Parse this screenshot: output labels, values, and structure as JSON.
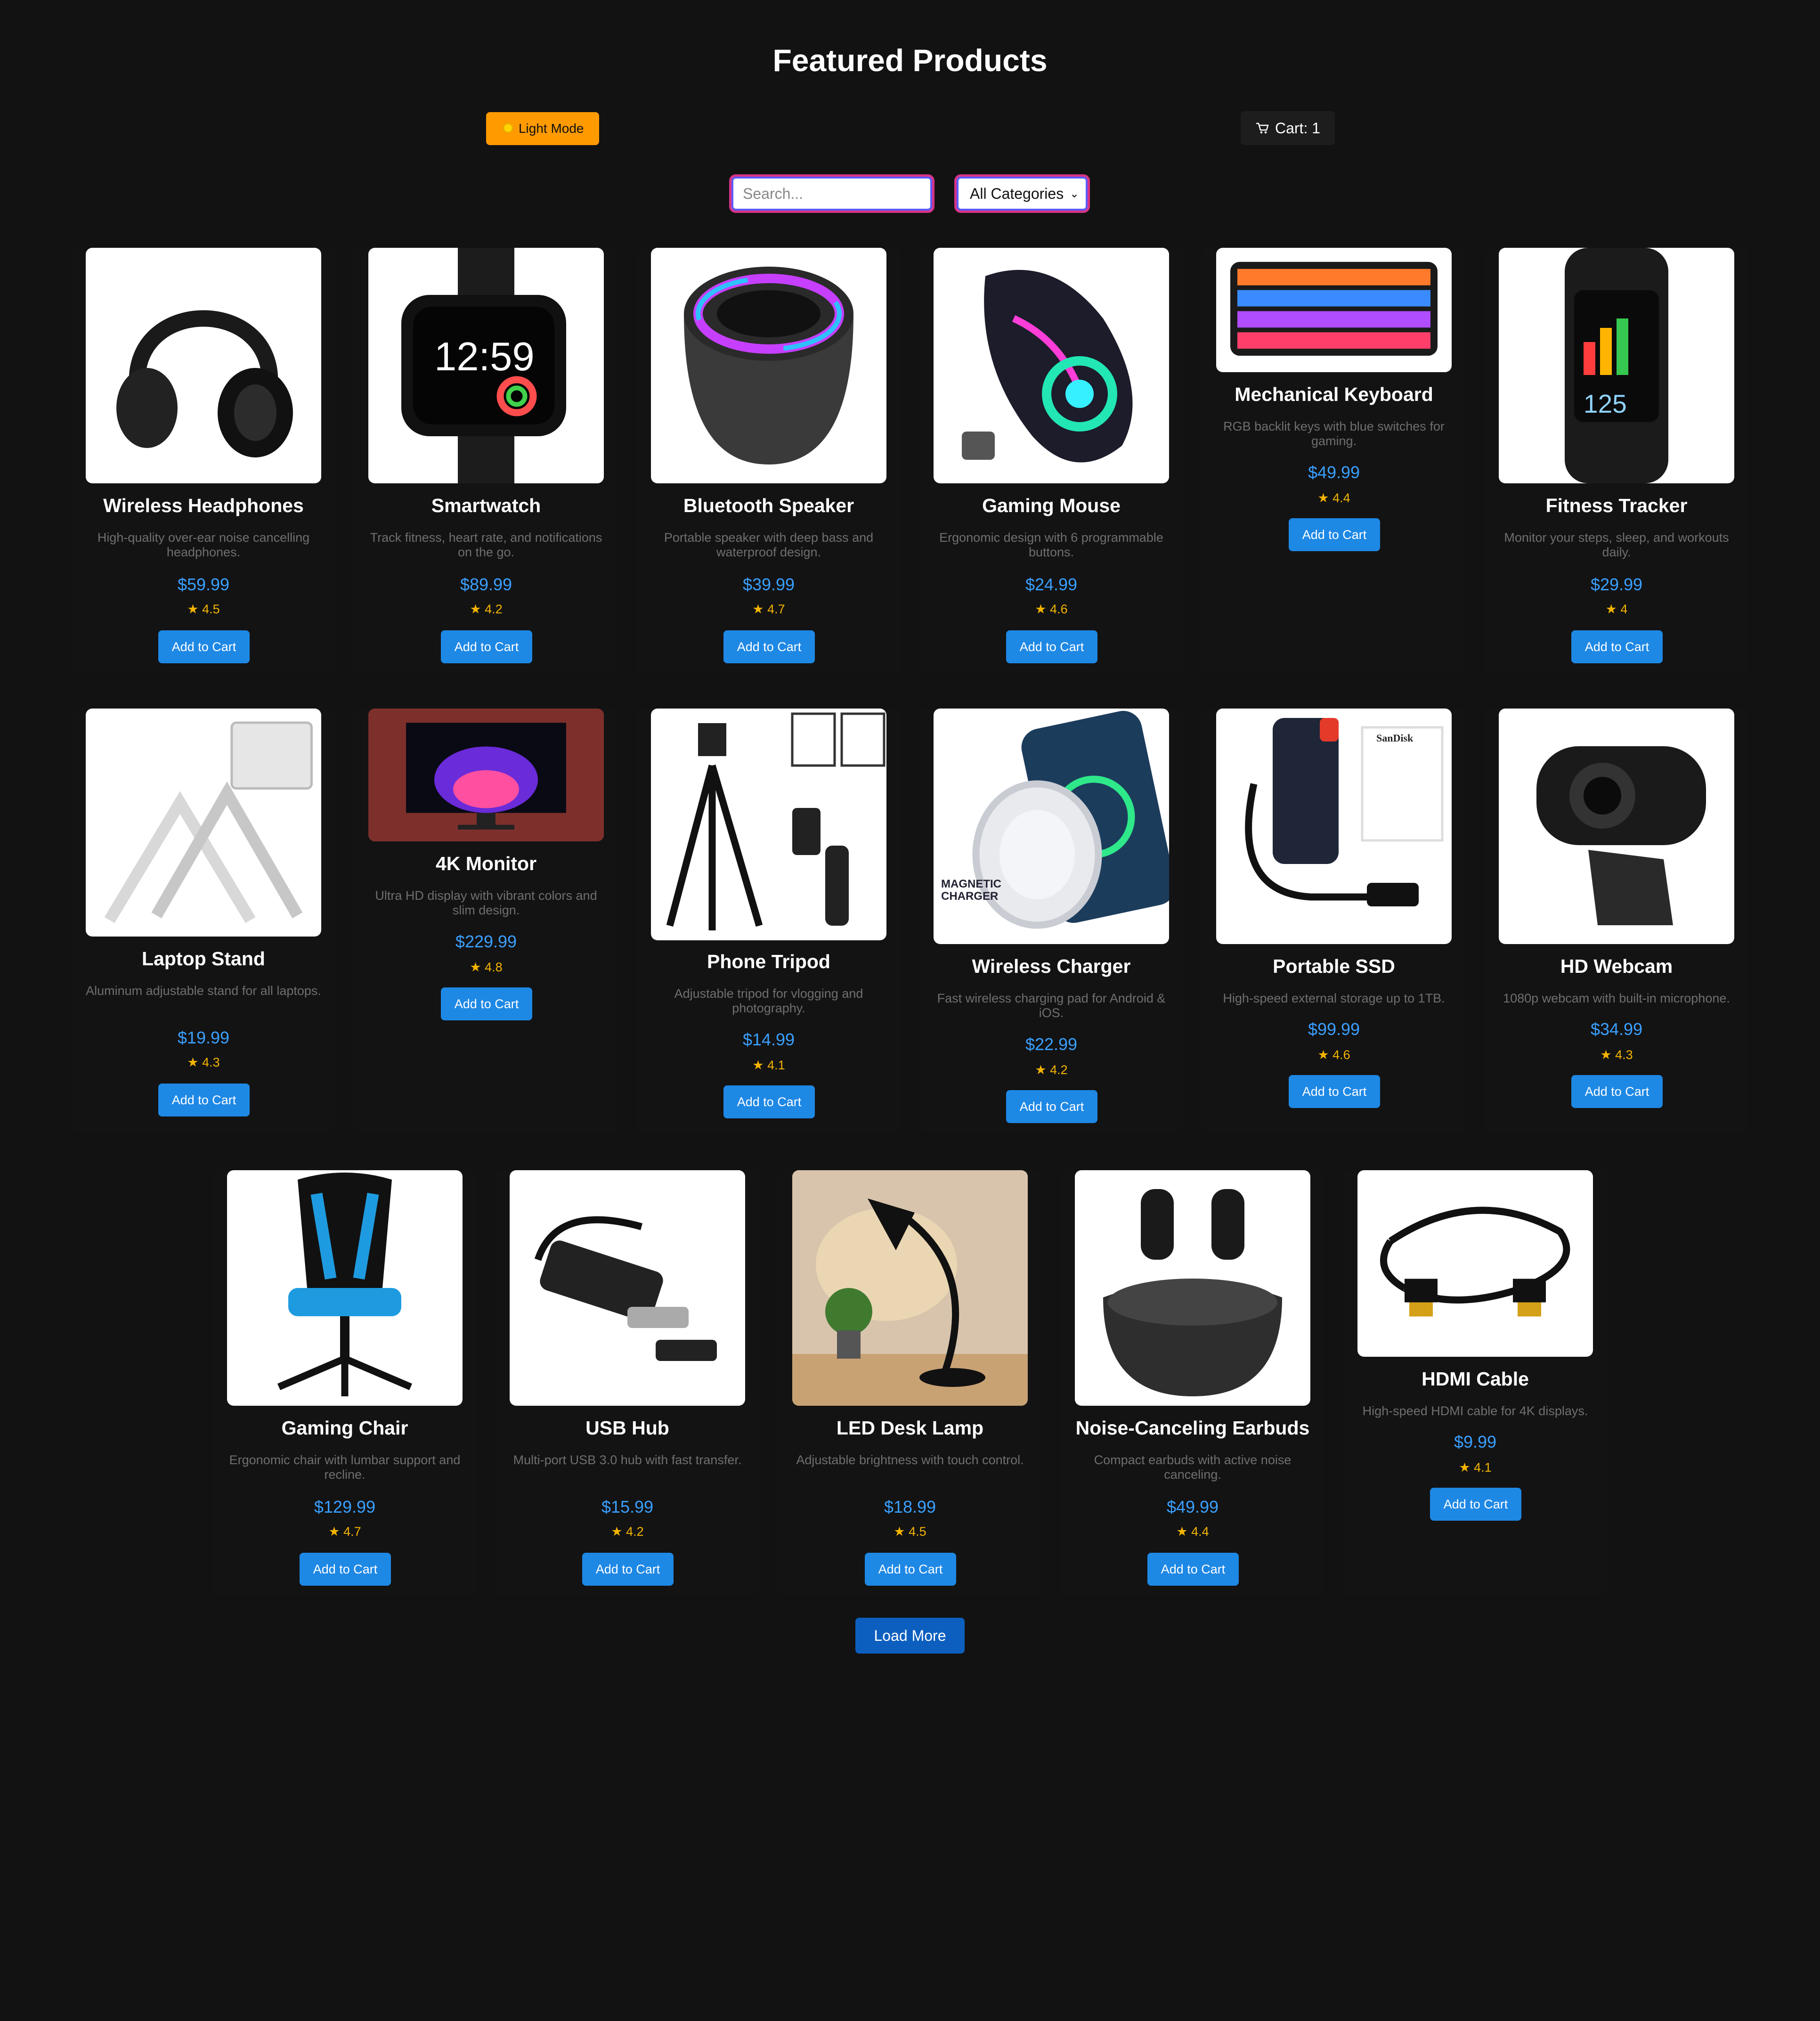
{
  "page": {
    "title": "Featured Products",
    "theme_toggle": "Light Mode",
    "cart_label": "Cart: 1",
    "search_placeholder": "Search...",
    "category_selected": "All Categories",
    "load_more": "Load More"
  },
  "colors": {
    "background": "#121212",
    "accent_blue": "#1e88e5",
    "price_blue": "#3aa0ff",
    "star_gold": "#f5b400",
    "theme_button": "#ff9a00",
    "input_border": "#d63384"
  },
  "products": [
    {
      "name": "Wireless Headphones",
      "desc": "High-quality over-ear noise cancelling headphones.",
      "price": "$59.99",
      "rating": "★ 4.5",
      "button": "Add to Cart"
    },
    {
      "name": "Smartwatch",
      "desc": "Track fitness, heart rate, and notifications on the go.",
      "price": "$89.99",
      "rating": "★ 4.2",
      "button": "Add to Cart"
    },
    {
      "name": "Bluetooth Speaker",
      "desc": "Portable speaker with deep bass and waterproof design.",
      "price": "$39.99",
      "rating": "★ 4.7",
      "button": "Add to Cart"
    },
    {
      "name": "Gaming Mouse",
      "desc": "Ergonomic design with 6 programmable buttons.",
      "price": "$24.99",
      "rating": "★ 4.6",
      "button": "Add to Cart"
    },
    {
      "name": "Mechanical Keyboard",
      "desc": "RGB backlit keys with blue switches for gaming.",
      "price": "$49.99",
      "rating": "★ 4.4",
      "button": "Add to Cart"
    },
    {
      "name": "Fitness Tracker",
      "desc": "Monitor your steps, sleep, and workouts daily.",
      "price": "$29.99",
      "rating": "★ 4",
      "button": "Add to Cart"
    },
    {
      "name": "Laptop Stand",
      "desc": "Aluminum adjustable stand for all laptops.",
      "price": "$19.99",
      "rating": "★ 4.3",
      "button": "Add to Cart"
    },
    {
      "name": "4K Monitor",
      "desc": "Ultra HD display with vibrant colors and slim design.",
      "price": "$229.99",
      "rating": "★ 4.8",
      "button": "Add to Cart"
    },
    {
      "name": "Phone Tripod",
      "desc": "Adjustable tripod for vlogging and photography.",
      "price": "$14.99",
      "rating": "★ 4.1",
      "button": "Add to Cart"
    },
    {
      "name": "Wireless Charger",
      "desc": "Fast wireless charging pad for Android & iOS.",
      "price": "$22.99",
      "rating": "★ 4.2",
      "button": "Add to Cart",
      "image_text": "MAGNETIC CHARGER"
    },
    {
      "name": "Portable SSD",
      "desc": "High-speed external storage up to 1TB.",
      "price": "$99.99",
      "rating": "★ 4.6",
      "button": "Add to Cart",
      "image_text": "SanDisk"
    },
    {
      "name": "HD Webcam",
      "desc": "1080p webcam with built-in microphone.",
      "price": "$34.99",
      "rating": "★ 4.3",
      "button": "Add to Cart"
    },
    {
      "name": "Gaming Chair",
      "desc": "Ergonomic chair with lumbar support and recline.",
      "price": "$129.99",
      "rating": "★ 4.7",
      "button": "Add to Cart"
    },
    {
      "name": "USB Hub",
      "desc": "Multi-port USB 3.0 hub with fast transfer.",
      "price": "$15.99",
      "rating": "★ 4.2",
      "button": "Add to Cart"
    },
    {
      "name": "LED Desk Lamp",
      "desc": "Adjustable brightness with touch control.",
      "price": "$18.99",
      "rating": "★ 4.5",
      "button": "Add to Cart"
    },
    {
      "name": "Noise-Canceling Earbuds",
      "desc": "Compact earbuds with active noise canceling.",
      "price": "$49.99",
      "rating": "★ 4.4",
      "button": "Add to Cart"
    },
    {
      "name": "HDMI Cable",
      "desc": "High-speed HDMI cable for 4K displays.",
      "price": "$9.99",
      "rating": "★ 4.1",
      "button": "Add to Cart"
    }
  ],
  "image_labels": {
    "watch_time": "12:59",
    "tracker_value": "125"
  }
}
